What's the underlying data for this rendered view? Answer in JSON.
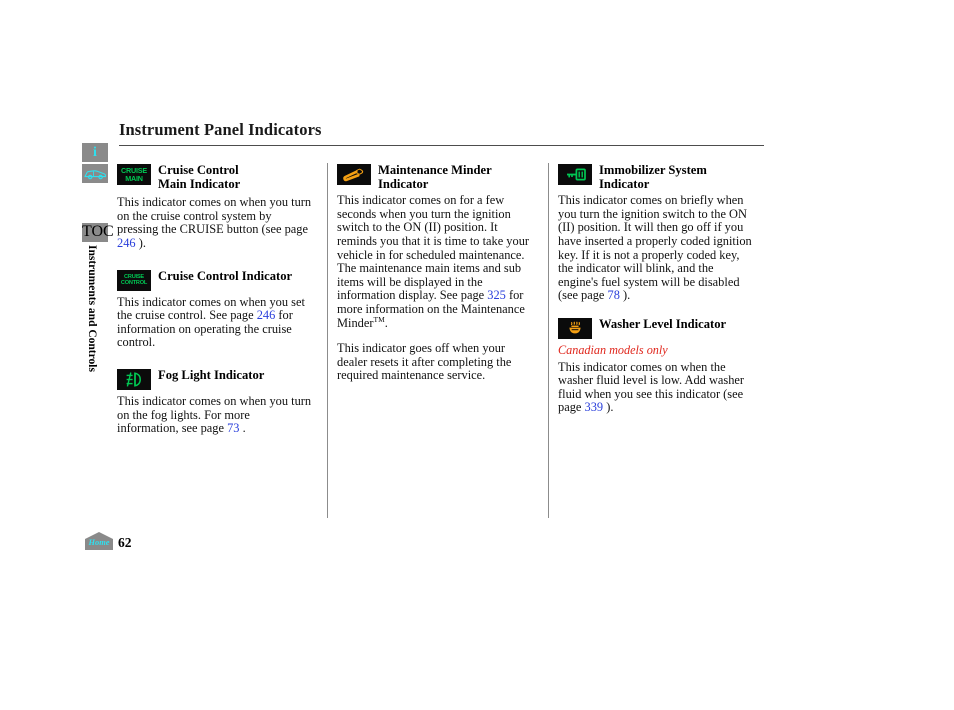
{
  "page": {
    "title": "Instrument Panel Indicators",
    "number": "62",
    "section_tab": "Instruments and Controls"
  },
  "sidebar": {
    "info_glyph": "i",
    "info_icon_name": "info-icon",
    "car_icon_name": "vehicle-icon",
    "toc_label": "TOC"
  },
  "footer": {
    "home_label": "Home"
  },
  "colors": {
    "link": "#2a3fdb",
    "indicator_green": "#00c853",
    "indicator_orange": "#f5a013",
    "note_red": "#e0281e",
    "sidebar_grey": "#8a8a8a",
    "sidebar_cyan": "#2ee0ef",
    "icon_background": "#0b0b0b"
  },
  "columns": [
    {
      "entries": [
        {
          "icon": "cruise-main-indicator-icon",
          "icon_text_line1": "CRUISE",
          "icon_text_line2": "MAIN",
          "title_line1": "Cruise Control",
          "title_line2": "Main Indicator",
          "body_before": "This indicator comes on when you turn on the cruise control system by pressing the CRUISE button (see page ",
          "page_ref": "246",
          "body_after": " )."
        },
        {
          "icon": "cruise-control-indicator-icon",
          "icon_text_line1": "CRUISE",
          "icon_text_line2": "CONTROL",
          "title_line1": "Cruise Control Indicator",
          "body_before": "This indicator comes on when you set the cruise control. See page ",
          "page_ref": "246",
          "body_after": " for information on operating the cruise control."
        },
        {
          "icon": "fog-light-indicator-icon",
          "title_line1": "Fog Light Indicator",
          "body_before": "This indicator comes on when you turn on the fog lights. For more information, see page ",
          "page_ref": "73",
          "body_after": " ."
        }
      ]
    },
    {
      "entries": [
        {
          "icon": "maintenance-minder-indicator-icon",
          "title_line1": "Maintenance Minder",
          "title_line2": "Indicator",
          "body_before": "This indicator comes on for a few seconds when you turn the ignition switch to the ON (II) position. It reminds you that it is time to take your vehicle in for scheduled maintenance. The maintenance main items and sub items will be displayed in the information display. See page ",
          "page_ref": "325",
          "body_after": " for more information on the Maintenance Minder",
          "trademark": "TM",
          "body_tail": ".",
          "body2": "This indicator goes off when your dealer resets it after completing the required maintenance service."
        }
      ]
    },
    {
      "entries": [
        {
          "icon": "immobilizer-system-indicator-icon",
          "title_line1": "Immobilizer System",
          "title_line2": "Indicator",
          "body_before": "This indicator comes on briefly when you turn the ignition switch to the ON (II) position. It will then go off if you have inserted a properly coded ignition key. If it is not a properly coded key, the indicator will blink, and the engine's fuel system will be disabled (see page ",
          "page_ref": "78",
          "body_after": " )."
        },
        {
          "icon": "washer-level-indicator-icon",
          "title_line1": "Washer Level Indicator",
          "note": "Canadian models only",
          "body_before": "This indicator comes on when the washer fluid level is low. Add washer fluid when you see this indicator (see page ",
          "page_ref": "339",
          "body_after": " )."
        }
      ]
    }
  ]
}
